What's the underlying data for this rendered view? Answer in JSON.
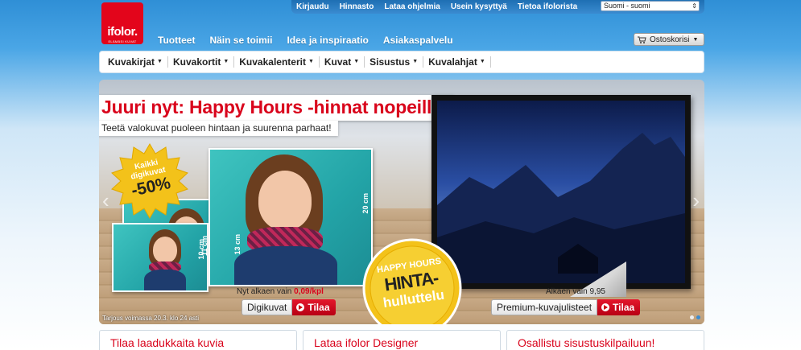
{
  "top_nav": {
    "links": [
      "Kirjaudu",
      "Hinnasto",
      "Lataa ohjelmia",
      "Usein kysyttyä",
      "Tietoa ifolorista"
    ],
    "language_select": "Suomi - suomi"
  },
  "logo": {
    "name": "ifolor.",
    "tagline": "ELÄMÄSI KUVAT"
  },
  "primary_nav": [
    "Tuotteet",
    "Näin se toimii",
    "Idea ja inspiraatio",
    "Asiakaspalvelu"
  ],
  "cart": {
    "label": "Ostoskorisi"
  },
  "category_nav": [
    "Kuvakirjat",
    "Kuvakortit",
    "Kuvakalenterit",
    "Kuvat",
    "Sisustus",
    "Kuvalahjat"
  ],
  "hero": {
    "headline": "Juuri nyt: Happy Hours -hinnat nopeille!",
    "subheadline": "Teetä valokuvat puoleen hintaan ja suurenna parhaat!",
    "burst": {
      "line1": "Kaikki",
      "line2": "digikuvat",
      "discount": "-50%"
    },
    "dims": {
      "large": "20 cm",
      "medium": "13 cm",
      "small": "10 cm",
      "smallh": "11 cm"
    },
    "left_price": {
      "prefix": "Nyt alkaen vain",
      "value": "0,09/kpl"
    },
    "left_button": {
      "label": "Digikuvat",
      "action": "Tilaa"
    },
    "right_price": {
      "text": "Alkaen vain 9,95"
    },
    "right_button": {
      "label": "Premium-kuvajulisteet",
      "action": "Tilaa"
    },
    "medallion": {
      "line1": "HAPPY HOURS",
      "line2": "HINTA-",
      "line3": "hullut­telu"
    },
    "offer_note": "Tarjous voimassa 20.3. klo 24 asti",
    "colors": {
      "accent": "#d9041c",
      "gold": "#f3c21a",
      "blue": "#2f8fd6"
    }
  },
  "cards": [
    "Tilaa laadukkaita kuvia",
    "Lataa ifolor Designer",
    "Osallistu sisustuskilpailuun!"
  ]
}
